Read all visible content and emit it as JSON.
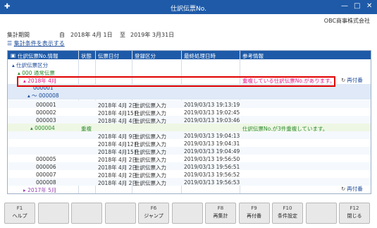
{
  "window": {
    "title": "仕訳伝票No.",
    "app_icon": "app-plus-icon",
    "controls": [
      "—",
      "□",
      "✕"
    ]
  },
  "company": "OBC商事株式会社",
  "period": {
    "label": "集計期間",
    "from_label": "自",
    "from_value": "2018年 4月 1日",
    "to_label": "至",
    "to_value": "2019年 3月31日"
  },
  "condition_link": "集計条件を表示する",
  "grid": {
    "headers": [
      "仕訳伝票No.情報",
      "状態",
      "伝票日付",
      "登録区分",
      "最終処理日時",
      "参考情報"
    ],
    "tree": {
      "root": "仕訳伝票区分",
      "normal": "000 通常伝票",
      "month1": "2018年 4月",
      "range": [
        "000001",
        "～ 000008"
      ],
      "month2": "2017年 5月"
    },
    "warning_month": "重複している仕訳伝票No.があります。",
    "rows": [
      {
        "no": "000001",
        "status": "",
        "date": "2018年 4月 2日",
        "type": "仕訳伝票入力",
        "ts": "2019/03/13 19:13:19",
        "note": ""
      },
      {
        "no": "000002",
        "status": "",
        "date": "2018年 4月15日",
        "type": "仕訳伝票入力",
        "ts": "2019/03/13 19:02:45",
        "note": ""
      },
      {
        "no": "000003",
        "status": "",
        "date": "2018年 4月 4日",
        "type": "仕訳伝票入力",
        "ts": "2019/03/13 19:03:46",
        "note": ""
      },
      {
        "no": "000004",
        "status": "重複",
        "date": "",
        "type": "",
        "ts": "",
        "note": "仕訳伝票No.が3件重複しています。"
      },
      {
        "no": "",
        "status": "",
        "date": "2018年 4月 9日",
        "type": "仕訳伝票入力",
        "ts": "2019/03/13 19:04:13",
        "note": ""
      },
      {
        "no": "",
        "status": "",
        "date": "2018年 4月12日",
        "type": "仕訳伝票入力",
        "ts": "2019/03/13 19:04:31",
        "note": ""
      },
      {
        "no": "",
        "status": "",
        "date": "2018年 4月15日",
        "type": "仕訳伝票入力",
        "ts": "2019/03/13 19:04:49",
        "note": ""
      },
      {
        "no": "000005",
        "status": "",
        "date": "2018年 4月 2日",
        "type": "仕訳伝票入力",
        "ts": "2019/03/13 19:56:50",
        "note": ""
      },
      {
        "no": "000006",
        "status": "",
        "date": "2018年 4月 2日",
        "type": "仕訳伝票入力",
        "ts": "2019/03/13 19:56:51",
        "note": ""
      },
      {
        "no": "000007",
        "status": "",
        "date": "2018年 4月 2日",
        "type": "仕訳伝票入力",
        "ts": "2019/03/13 19:56:52",
        "note": ""
      },
      {
        "no": "000008",
        "status": "",
        "date": "2018年 4月 2日",
        "type": "仕訳伝票入力",
        "ts": "2019/03/13 19:56:53",
        "note": ""
      }
    ],
    "renban": "再付番"
  },
  "fkeys": [
    {
      "key": "F1",
      "label": "ヘルプ"
    },
    {
      "key": "",
      "label": ""
    },
    {
      "key": "",
      "label": ""
    },
    {
      "key": "",
      "label": ""
    },
    {
      "key": "F6",
      "label": "ジャンプ"
    },
    {
      "key": "",
      "label": ""
    },
    {
      "key": "F8",
      "label": "再集計"
    },
    {
      "key": "F9",
      "label": "再付番"
    },
    {
      "key": "F10",
      "label": "条件設定"
    },
    {
      "key": "",
      "label": ""
    },
    {
      "key": "F12",
      "label": "閉じる"
    }
  ]
}
